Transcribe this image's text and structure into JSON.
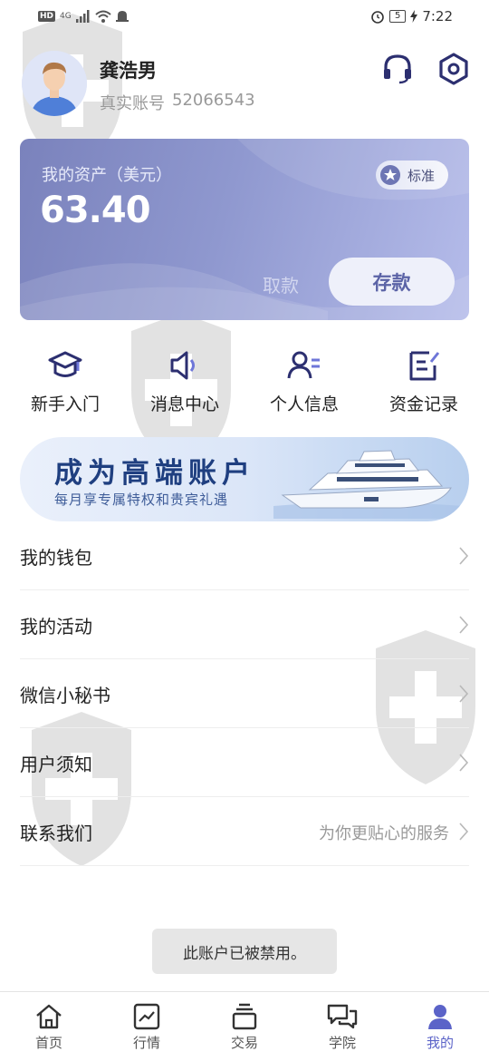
{
  "status_bar": {
    "left_badges": [
      "HD",
      "4G"
    ],
    "battery": "5",
    "time": "7:22"
  },
  "profile": {
    "name": "龚浩男",
    "account_label": "真实账号",
    "account_number": "52066543",
    "support_icon": "headset-icon",
    "settings_icon": "settings-hex-icon"
  },
  "asset_card": {
    "label": "我的资产（美元）",
    "value": "63.40",
    "level_badge": "标准",
    "withdraw_label": "取款",
    "deposit_label": "存款",
    "colors": {
      "card_start": "#7a82bc",
      "card_end": "#b5bcea",
      "deposit_text": "#5b63a6"
    }
  },
  "quick_actions": [
    {
      "label": "新手入门",
      "icon": "graduation-cap-icon"
    },
    {
      "label": "消息中心",
      "icon": "speaker-icon"
    },
    {
      "label": "个人信息",
      "icon": "person-card-icon"
    },
    {
      "label": "资金记录",
      "icon": "note-edit-icon"
    }
  ],
  "banner": {
    "title": "成为高端账户",
    "subtitle": "每月享专属特权和贵宾礼遇",
    "image": "yacht-icon"
  },
  "menu": [
    {
      "label": "我的钱包",
      "hint": ""
    },
    {
      "label": "我的活动",
      "hint": ""
    },
    {
      "label": "微信小秘书",
      "hint": ""
    },
    {
      "label": "用户须知",
      "hint": ""
    },
    {
      "label": "联系我们",
      "hint": "为你更贴心的服务"
    }
  ],
  "toast": "此账户已被禁用。",
  "bottom_nav": [
    {
      "label": "首页",
      "icon": "home-icon",
      "active": false
    },
    {
      "label": "行情",
      "icon": "chart-icon",
      "active": false
    },
    {
      "label": "交易",
      "icon": "stack-icon",
      "active": false
    },
    {
      "label": "学院",
      "icon": "chat-bubbles-icon",
      "active": false
    },
    {
      "label": "我的",
      "icon": "user-icon",
      "active": true
    }
  ],
  "colors": {
    "accent": "#5b63c8",
    "icon_dark": "#2c2f70",
    "text_secondary": "#999999"
  }
}
